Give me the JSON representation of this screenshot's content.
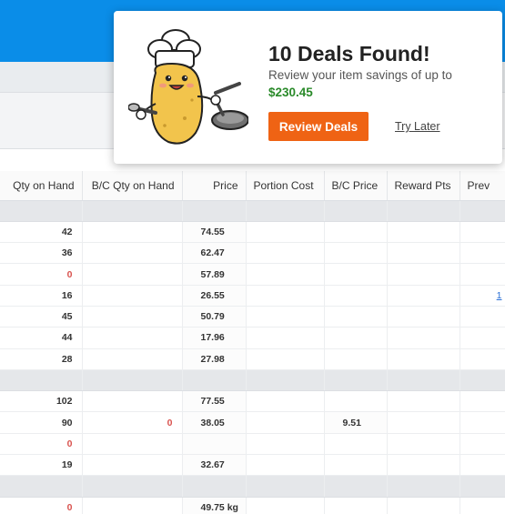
{
  "popup": {
    "title": "10 Deals Found!",
    "subtitle": "Review your item savings of up to",
    "amount": "$230.45",
    "review_button": "Review Deals",
    "later_link": "Try Later",
    "mascot_icon": "chef-potato-icon"
  },
  "table": {
    "headers": [
      "Qty on Hand",
      "B/C Qty on Hand",
      "Price",
      "Portion Cost",
      "B/C Price",
      "Reward Pts",
      "Prev"
    ],
    "rows": [
      {
        "group": true
      },
      {
        "qty": "42",
        "bc_qty": "",
        "price": "74.55",
        "portion": "",
        "bc_price": "",
        "reward": "",
        "prev": ""
      },
      {
        "qty": "36",
        "bc_qty": "",
        "price": "62.47",
        "portion": "",
        "bc_price": "",
        "reward": "",
        "prev": ""
      },
      {
        "qty": "0",
        "bc_qty": "",
        "price": "57.89",
        "portion": "",
        "bc_price": "",
        "reward": "",
        "prev": ""
      },
      {
        "qty": "16",
        "bc_qty": "",
        "price": "26.55",
        "portion": "",
        "bc_price": "",
        "reward": "",
        "prev": "1"
      },
      {
        "qty": "45",
        "bc_qty": "",
        "price": "50.79",
        "portion": "",
        "bc_price": "",
        "reward": "",
        "prev": ""
      },
      {
        "qty": "44",
        "bc_qty": "",
        "price": "17.96",
        "portion": "",
        "bc_price": "",
        "reward": "",
        "prev": ""
      },
      {
        "qty": "28",
        "bc_qty": "",
        "price": "27.98",
        "portion": "",
        "bc_price": "",
        "reward": "",
        "prev": ""
      },
      {
        "group": true
      },
      {
        "qty": "102",
        "bc_qty": "",
        "price": "77.55",
        "portion": "",
        "bc_price": "",
        "reward": "",
        "prev": ""
      },
      {
        "qty": "90",
        "bc_qty": "0",
        "price": "38.05",
        "portion": "",
        "bc_price": "9.51",
        "reward": "",
        "prev": ""
      },
      {
        "qty": "0",
        "bc_qty": "",
        "price": "",
        "portion": "",
        "bc_price": "",
        "reward": "",
        "prev": ""
      },
      {
        "qty": "19",
        "bc_qty": "",
        "price": "32.67",
        "portion": "",
        "bc_price": "",
        "reward": "",
        "prev": ""
      },
      {
        "group": true
      },
      {
        "qty": "0",
        "bc_qty": "",
        "price": "49.75 kg",
        "portion": "",
        "bc_price": "",
        "reward": "",
        "prev": ""
      }
    ]
  },
  "colors": {
    "header_blue": "#0a8de8",
    "button_orange": "#ef6314",
    "savings_green": "#2a8a2a",
    "zero_red": "#d9534f",
    "link_blue": "#2a6fd6"
  }
}
